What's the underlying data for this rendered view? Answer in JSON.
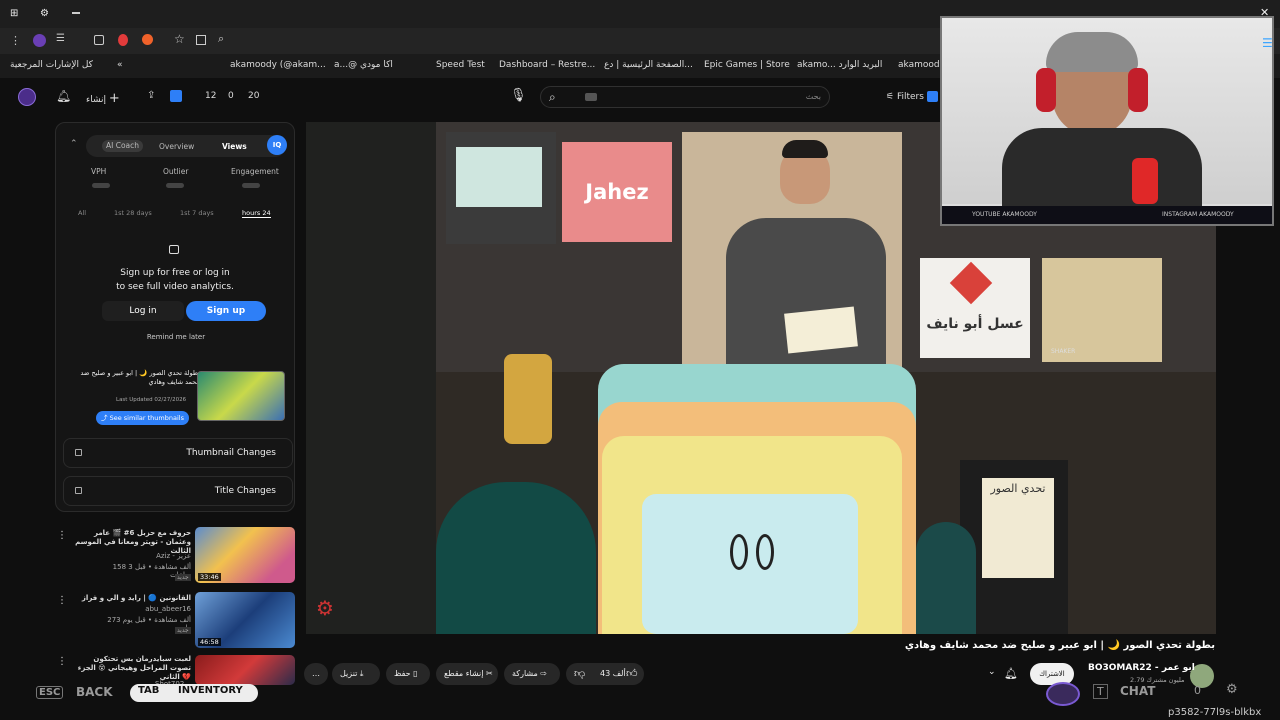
{
  "toolbar": {
    "bookmarks": [
      "كل الإشارات المرجعية",
      "akamoody (@akam...",
      "a...@ اكا مودي",
      "Speed Test",
      "Dashboard – Restre...",
      "الصفحة الرئيسية | دع...",
      "Epic Games | Store",
      "akamo... البريد الوارد",
      "akamoody"
    ]
  },
  "yt_header": {
    "counters": [
      "12",
      "0",
      "20"
    ],
    "search_placeholder": "بحث",
    "filters_label": "Filters",
    "create_label": "إنشاء"
  },
  "panel": {
    "tabs": [
      "AI Coach",
      "Overview",
      "Views"
    ],
    "badge": "IQ",
    "metrics": [
      "VPH",
      "Outlier",
      "Engagement"
    ],
    "ranges": [
      "All",
      "1st 28 days",
      "1st 7 days",
      "hours 24"
    ],
    "signup_line1": "Sign up for free or log in",
    "signup_line2": "to see full video analytics.",
    "login_label": "Log in",
    "signup_label": "Sign up",
    "remind_label": "Remind me later",
    "card_title": "بطولة تحدي الصور 🌙 | ابو عبير و صليح ضد محمد شايف وهادي",
    "card_updated": "Last Updated 02/27/2026",
    "similar_label": "See similar thumbnails",
    "thumb_changes": "Thumbnail Changes",
    "title_changes": "Title Changes"
  },
  "recommended": [
    {
      "title": "حروف مع حزبل 6# 🎬 عامر وعثمان - تويتر ومعانا في الموسم الثالث",
      "channel": "Aziz - عزيز",
      "meta": "158 ألف مشاهدة • قبل 3 ساعات",
      "badge": "جديد",
      "duration": "33:46"
    },
    {
      "title": "القانونين 🔵 | رايد و الي و فراز",
      "channel": "abu_abeer16",
      "meta": "273 ألف مشاهدة • قبل يوم واحد",
      "badge": "جديد",
      "duration": "46:58"
    },
    {
      "title": "لعبت سبايدرمان بس تحتكون تصوت المراحل وهيجاني 😵 الجزء الثاني 💔",
      "channel": "Shot702",
      "meta": "",
      "badge": "",
      "duration": ""
    }
  ],
  "video": {
    "title": "بطولة تحدي الصور 🌙 | ابو عبير و صليح ضد محمد شايف وهادي",
    "set_labels": [
      "Jahez",
      "عسل أبو نايف",
      "تحدي الصور",
      "SHAKER"
    ]
  },
  "channel": {
    "name": "BO3OMAR22 - ابو عمر",
    "subs": "2.79 مليون مشترك",
    "subscribe_label": "الاشتراك"
  },
  "actions": {
    "likes": "43 ألف",
    "share": "مشاركة",
    "clip": "إنشاء مقطع",
    "save": "حفظ",
    "download": "تنزيل"
  },
  "webcam": {
    "youtube_tag": "YOUTUBE AKAMOODY",
    "instagram_tag": "INSTAGRAM AKAMOODY"
  },
  "game_hud": {
    "esc": "ESC",
    "back": "BACK",
    "tab": "TAB",
    "inventory": "INVENTORY",
    "t": "T",
    "chat": "CHAT",
    "count": "0"
  },
  "session_id": "p3582-77l9s-blkbx",
  "colors": {
    "accent": "#2e7ff7",
    "background": "#0f0f0f",
    "panel": "#151515"
  }
}
